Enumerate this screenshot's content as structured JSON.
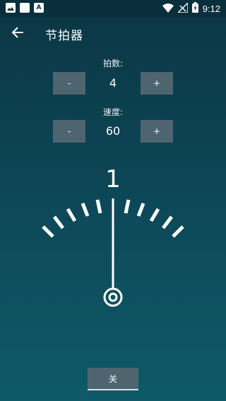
{
  "status_bar": {
    "left_icons": [
      "image-icon",
      "square-icon",
      "a-icon"
    ],
    "a_icon_label": "A",
    "right_icons": [
      "wifi-icon",
      "signal-icon",
      "battery-icon"
    ],
    "time": "9:12"
  },
  "app_bar": {
    "title": "节拍器",
    "back_icon": "arrow-left-icon"
  },
  "beats": {
    "label": "拍数:",
    "value": "4",
    "minus_label": "-",
    "plus_label": "+"
  },
  "tempo": {
    "label": "速度:",
    "value": "60",
    "minus_label": "-",
    "plus_label": "+"
  },
  "metronome": {
    "current_beat": "1"
  },
  "toggle_button": {
    "label": "关"
  },
  "colors": {
    "background_top": "#0c3644",
    "background_bottom": "#0e5a68",
    "button": "#4e6570",
    "foreground": "#ffffff"
  }
}
